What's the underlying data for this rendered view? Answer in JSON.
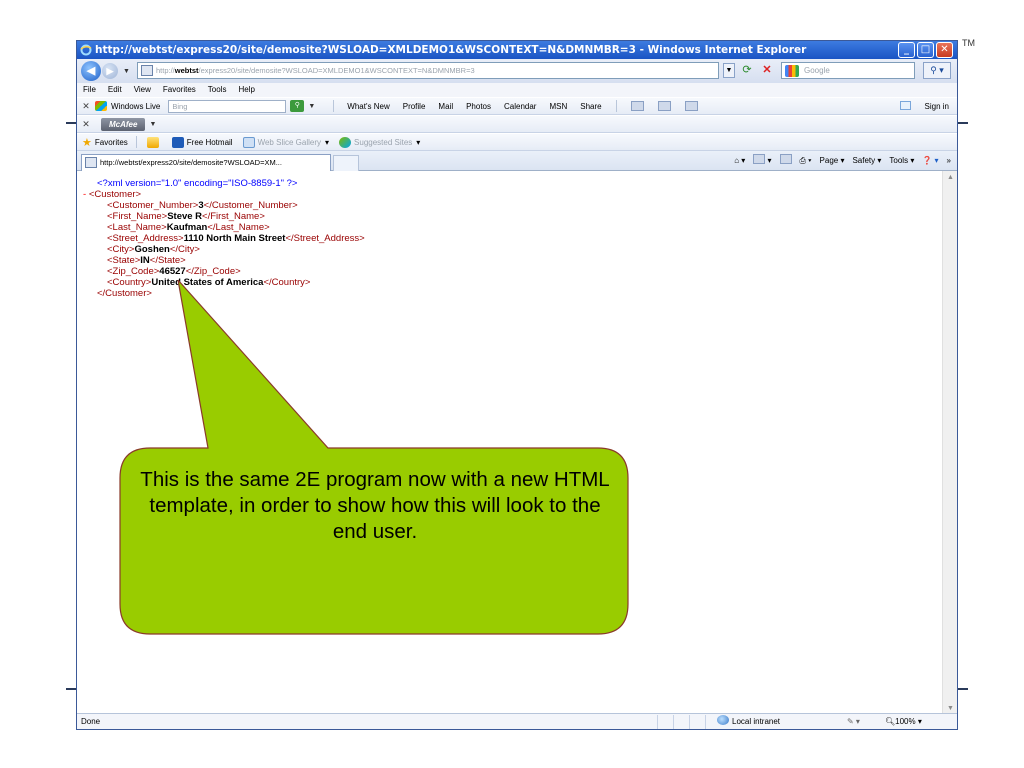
{
  "slide": {
    "trademark": "TM",
    "callout_text": "This is the same 2E program now with a new HTML template, in order to show how this will look to the end user.",
    "callout_color": "#99cc00",
    "callout_border": "#8a3a2a"
  },
  "window": {
    "title": "http://webtst/express20/site/demosite?WSLOAD=XMLDEMO1&WSCONTEXT=N&DMNMBR=3 - Windows Internet Explorer",
    "buttons": [
      "minimize",
      "maximize",
      "close"
    ]
  },
  "address_bar": {
    "url_prefix": "http://",
    "url_host": "webtst",
    "url_path": "/express20/site/demosite?WSLOAD=XMLDEMO1&WSCONTEXT=N&DMNMBR=3",
    "search_placeholder": "Google"
  },
  "menu": [
    "File",
    "Edit",
    "View",
    "Favorites",
    "Tools",
    "Help"
  ],
  "windows_live_bar": {
    "brand": "Windows Live",
    "search_placeholder": "Bing",
    "links": [
      "What's New",
      "Profile",
      "Mail",
      "Photos",
      "Calendar",
      "MSN",
      "Share"
    ],
    "sign_in": "Sign in"
  },
  "mcafee_bar": {
    "brand": "McAfee"
  },
  "favorites_bar": {
    "label": "Favorites",
    "items": [
      "Free Hotmail",
      "Web Slice Gallery",
      "Suggested Sites"
    ]
  },
  "tab": {
    "title": "http://webtst/express20/site/demosite?WSLOAD=XM..."
  },
  "command_bar": {
    "items": [
      "Page",
      "Safety",
      "Tools"
    ]
  },
  "xml": {
    "declaration": "<?xml version=\"1.0\" encoding=\"ISO-8859-1\" ?>",
    "collapse": "-",
    "root_open": "<Customer>",
    "root_close": "</Customer>",
    "fields": [
      {
        "open": "<Customer_Number>",
        "value": "3",
        "close": "</Customer_Number>"
      },
      {
        "open": "<First_Name>",
        "value": "Steve R",
        "close": "</First_Name>"
      },
      {
        "open": "<Last_Name>",
        "value": "Kaufman",
        "close": "</Last_Name>"
      },
      {
        "open": "<Street_Address>",
        "value": "1110 North Main Street",
        "close": "</Street_Address>"
      },
      {
        "open": "<City>",
        "value": "Goshen",
        "close": "</City>"
      },
      {
        "open": "<State>",
        "value": "IN",
        "close": "</State>"
      },
      {
        "open": "<Zip_Code>",
        "value": "46527",
        "close": "</Zip_Code>"
      },
      {
        "open": "<Country>",
        "value": "United States of America",
        "close": "</Country>"
      }
    ]
  },
  "status_bar": {
    "status": "Done",
    "zone": "Local intranet",
    "zoom": "100%"
  }
}
